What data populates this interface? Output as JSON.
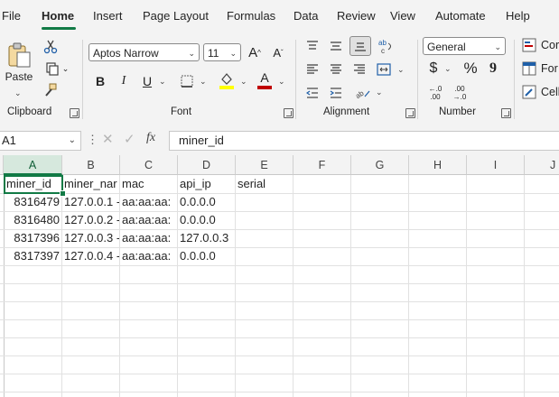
{
  "menu": {
    "tabs": [
      "File",
      "Home",
      "Insert",
      "Page Layout",
      "Formulas",
      "Data",
      "Review",
      "View",
      "Automate",
      "Help"
    ],
    "active": "Home"
  },
  "ribbon": {
    "clipboard": {
      "paste_label": "Paste",
      "group_label": "Clipboard"
    },
    "font": {
      "font_name": "Aptos Narrow",
      "font_size": "11",
      "group_label": "Font",
      "bold": "B",
      "italic": "I",
      "underline": "U",
      "grow": "A",
      "shrink": "A",
      "font_color": "A",
      "fill_color_hex": "#ffff00",
      "font_color_hex": "#c00000"
    },
    "alignment": {
      "group_label": "Alignment"
    },
    "number": {
      "format": "General",
      "group_label": "Number",
      "currency": "$",
      "percent": "%",
      "comma": "9",
      "inc_decimal_top": "←.0",
      "inc_decimal_bottom": ".00",
      "dec_decimal_top": ".00",
      "dec_decimal_bottom": "→.0"
    },
    "styles": {
      "item1": "Cor",
      "item2": "For",
      "item3": "Cell"
    }
  },
  "formula_bar": {
    "name_box": "A1",
    "fx": "fx",
    "content": "miner_id"
  },
  "grid": {
    "columns": [
      "A",
      "B",
      "C",
      "D",
      "E",
      "F",
      "G",
      "H",
      "I",
      "J"
    ],
    "selected_column": "A",
    "header_row": [
      "miner_id",
      "miner_nar",
      "mac",
      "api_ip",
      "serial"
    ],
    "rows": [
      [
        "8316479",
        "127.0.0.1 -",
        "aa:aa:aa:",
        "0.0.0.0"
      ],
      [
        "8316480",
        "127.0.0.2 -",
        "aa:aa:aa:",
        "0.0.0.0"
      ],
      [
        "8317396",
        "127.0.0.3 -",
        "aa:aa:aa:",
        "127.0.0.3"
      ],
      [
        "8317397",
        "127.0.0.4 -",
        "aa:aa:aa:",
        "0.0.0.0"
      ]
    ]
  },
  "colors": {
    "accent": "#117a45",
    "ribbon_bg": "#f3f3f3",
    "gridline": "#e1e1e1"
  }
}
